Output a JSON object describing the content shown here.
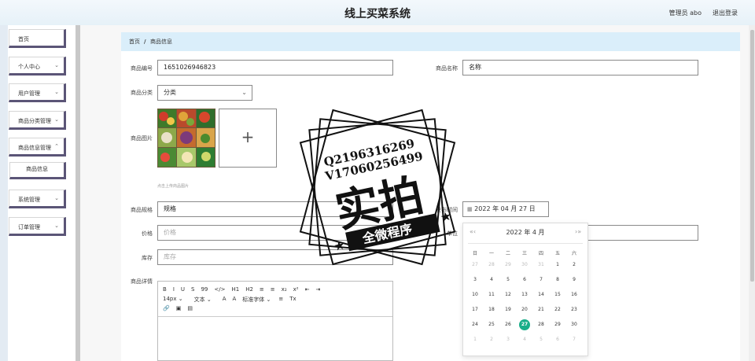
{
  "header": {
    "title": "线上买菜系统",
    "user": "管理员 abo",
    "logout": "退出登录"
  },
  "sidebar": {
    "items": [
      {
        "label": "首页"
      },
      {
        "label": "个人中心"
      },
      {
        "label": "用户管理"
      },
      {
        "label": "商品分类管理"
      },
      {
        "label": "商品信息管理"
      },
      {
        "label": "商品信息"
      },
      {
        "label": "系统管理"
      },
      {
        "label": "订单管理"
      }
    ]
  },
  "breadcrumb": {
    "home": "首页",
    "sep": "/",
    "current": "商品信息"
  },
  "form": {
    "code_label": "商品编号",
    "code_value": "1651026946823",
    "name_label": "商品名称",
    "name_value": "名称",
    "category_label": "商品分类",
    "category_value": "分类",
    "image_label": "商品图片",
    "image_hint": "点击上传商品图片",
    "upload_plus": "+",
    "spec_label": "商品规格",
    "spec_value": "规格",
    "date_label": "发布时间",
    "date_value": "2022 年 04 月 27 日",
    "price_label": "价格",
    "price_placeholder": "价格",
    "unit_label": "单位",
    "stock_label": "库存",
    "stock_placeholder": "库存",
    "detail_label": "商品详情"
  },
  "editor": {
    "row1": [
      "B",
      "I",
      "U",
      "S",
      "99",
      "</>",
      "H1",
      "H2",
      "≡",
      "≡",
      "x₂",
      "x²",
      "⇤",
      "⇥"
    ],
    "row2": [
      "14px ⌄",
      "文本 ⌄",
      "A",
      "A",
      "标准字体 ⌄",
      "≡",
      "Tx"
    ],
    "row3": [
      "🔗",
      "▣",
      "▤"
    ]
  },
  "calendar": {
    "header": "2022 年  4 月",
    "prev": "«‹",
    "next": "›»",
    "weekdays": [
      "日",
      "一",
      "二",
      "三",
      "四",
      "五",
      "六"
    ],
    "weeks": [
      [
        "27",
        "28",
        "29",
        "30",
        "31",
        "1",
        "2"
      ],
      [
        "3",
        "4",
        "5",
        "6",
        "7",
        "8",
        "9"
      ],
      [
        "10",
        "11",
        "12",
        "13",
        "14",
        "15",
        "16"
      ],
      [
        "17",
        "18",
        "19",
        "20",
        "21",
        "22",
        "23"
      ],
      [
        "24",
        "25",
        "26",
        "27",
        "28",
        "29",
        "30"
      ],
      [
        "1",
        "2",
        "3",
        "4",
        "5",
        "6",
        "7"
      ]
    ],
    "selected": "27"
  },
  "watermark": {
    "line1": "Q2196316269",
    "line2": "V17060256499",
    "main": "实拍",
    "banner": "全微程序"
  },
  "colors": {
    "accent": "#1aae8a",
    "breadcrumb_bg": "#daeefa",
    "menu_border": "#5b5577"
  }
}
